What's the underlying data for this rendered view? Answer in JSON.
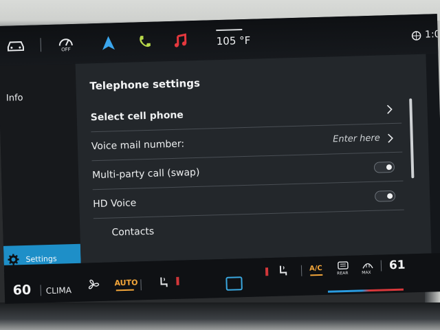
{
  "topbar": {
    "icons": [
      "car-icon",
      "speed-limit-off-icon",
      "navigation-icon",
      "phone-icon",
      "music-icon",
      "globe-icon"
    ],
    "off_label": "OFF",
    "outside_temp": "105 °F",
    "clock": "1:0"
  },
  "nav": {
    "info_label": "Info",
    "settings_label": "Settings"
  },
  "telephone": {
    "title": "Telephone settings",
    "rows": [
      {
        "label": "Select cell phone",
        "control": "chevron"
      },
      {
        "label": "Voice mail number:",
        "value": "Enter here",
        "control": "chevron"
      },
      {
        "label": "Multi-party call (swap)",
        "control": "toggle"
      },
      {
        "label": "HD Voice",
        "control": "toggle"
      },
      {
        "label": "Contacts",
        "control": "none"
      }
    ]
  },
  "climate": {
    "temp_left": "60",
    "clima_label": "CLIMA",
    "auto_label": "AUTO",
    "ac_label": "A/C",
    "rear_label": "REAR",
    "max_label": "MAX",
    "temp_right": "61"
  },
  "colors": {
    "accent_blue": "#1e8fc8",
    "accent_orange": "#f3a63a",
    "heat_red": "#d8383b",
    "nav_arrow": "#3ba6ee",
    "phone_green": "#b8d84a",
    "music_red": "#e5383e"
  }
}
